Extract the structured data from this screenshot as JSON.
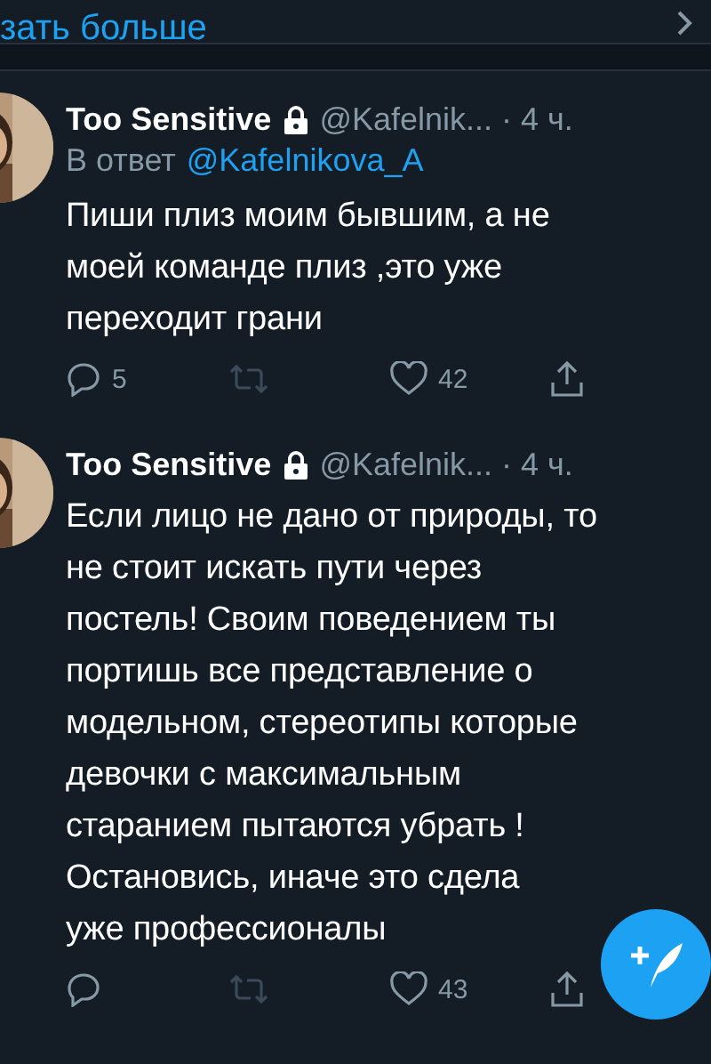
{
  "show_more": {
    "label": "зать больше"
  },
  "tweets": [
    {
      "name": "Too Sensitive",
      "locked": true,
      "handle": "@Kafelnik...",
      "time": "· 4 ч.",
      "reply_prefix": "В ответ",
      "reply_to": "@Kafelnikova_A",
      "text": "Пиши плиз моим бывшим, а не\nмоей команде плиз ,это уже\nпереходит грани",
      "replies": "5",
      "likes": "42"
    },
    {
      "name": "Too Sensitive",
      "locked": true,
      "handle": "@Kafelnik...",
      "time": "· 4 ч.",
      "text": "Если лицо не дано от природы, то\nне стоит искать пути через\nпостель! Своим поведением ты\nпортишь все представление о\nмодельном, стереотипы которые\nдевочки с максимальным\nстаранием пытаются убрать !\nОстановись, иначе это сдела\nуже профессионалы",
      "likes": "43"
    }
  ]
}
